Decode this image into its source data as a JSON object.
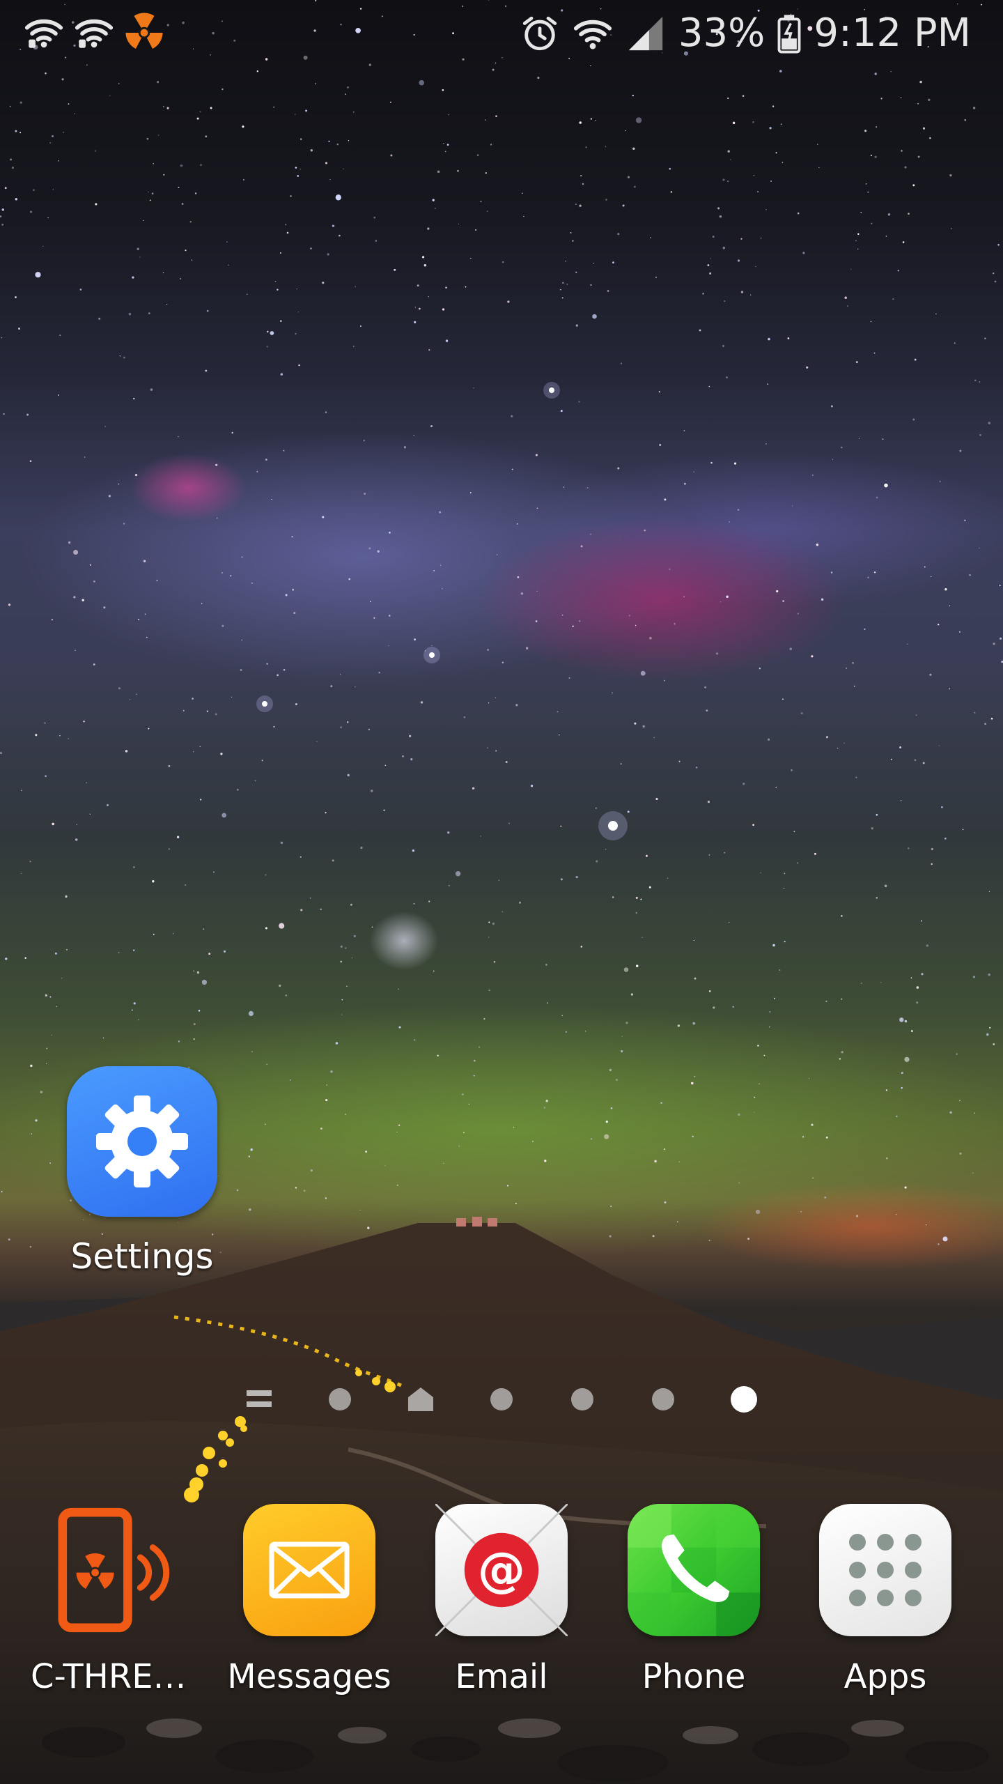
{
  "status_bar": {
    "left_icons": [
      "wifi-alert-icon",
      "wifi-alert-icon",
      "radiation-icon"
    ],
    "right_icons": [
      "alarm-icon",
      "wifi-icon",
      "cell-signal-icon",
      "battery-icon"
    ],
    "battery_percent": "33%",
    "time": "9:12 PM"
  },
  "home_screen": {
    "apps": [
      {
        "label": "Settings",
        "icon": "gear-icon",
        "color": "#3b82f6"
      }
    ],
    "page_indicator": {
      "items": [
        "apps-list-icon",
        "dot",
        "home-icon",
        "dot",
        "dot",
        "dot",
        "dot"
      ],
      "active_index": 6
    }
  },
  "dock": {
    "apps": [
      {
        "label": "C-THREA...",
        "icon": "radiation-phone-icon",
        "color": "#f05a14"
      },
      {
        "label": "Messages",
        "icon": "envelope-icon",
        "color": "#fbb116"
      },
      {
        "label": "Email",
        "icon": "at-sign-icon",
        "color": "#e0232f"
      },
      {
        "label": "Phone",
        "icon": "phone-handset-icon",
        "color": "#2fbd2f"
      },
      {
        "label": "Apps",
        "icon": "app-grid-icon",
        "color": "#f2f2f2"
      }
    ]
  }
}
